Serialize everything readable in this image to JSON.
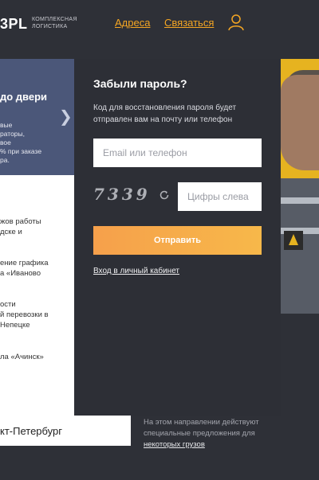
{
  "header": {
    "logo": "3PL",
    "logo_sub_line1": "КОМПЛЕКСНАЯ",
    "logo_sub_line2": "ЛОГИСТИКА",
    "nav": [
      "Адреса",
      "Связаться"
    ],
    "user_icon": "user-icon"
  },
  "promo": {
    "title": "до двери",
    "lines": [
      "вые",
      "раторы,",
      "вое",
      "% при заказе",
      "ра."
    ],
    "arrow": "❯"
  },
  "news": {
    "items": [
      [
        "жов работы",
        "дске и"
      ],
      [
        "ение графика",
        "а «Иваново"
      ],
      [
        "ости",
        "й перевозки в",
        "Непецке"
      ],
      [
        "ла «Ачинск»"
      ]
    ]
  },
  "city": {
    "value": "кт-Петербург"
  },
  "bottom_note": {
    "line1": "На этом направлении действуют",
    "line2": "специальные предложения для",
    "link": "некоторых грузов"
  },
  "modal": {
    "title": "Забыли пароль?",
    "description": "Код для восстановления пароля будет отправлен вам на почту или телефон",
    "email_placeholder": "Email или телефон",
    "captcha_text": "7339",
    "refresh_icon": "refresh-icon",
    "captcha_placeholder": "Цифры слева",
    "submit_label": "Отправить",
    "login_link": "Вход в личный кабинет"
  },
  "colors": {
    "accent": "#f5a623",
    "button_gradient_start": "#f6a04b",
    "button_gradient_end": "#f7b84a",
    "background": "#2e3037",
    "promo_bg": "#4b5779"
  }
}
